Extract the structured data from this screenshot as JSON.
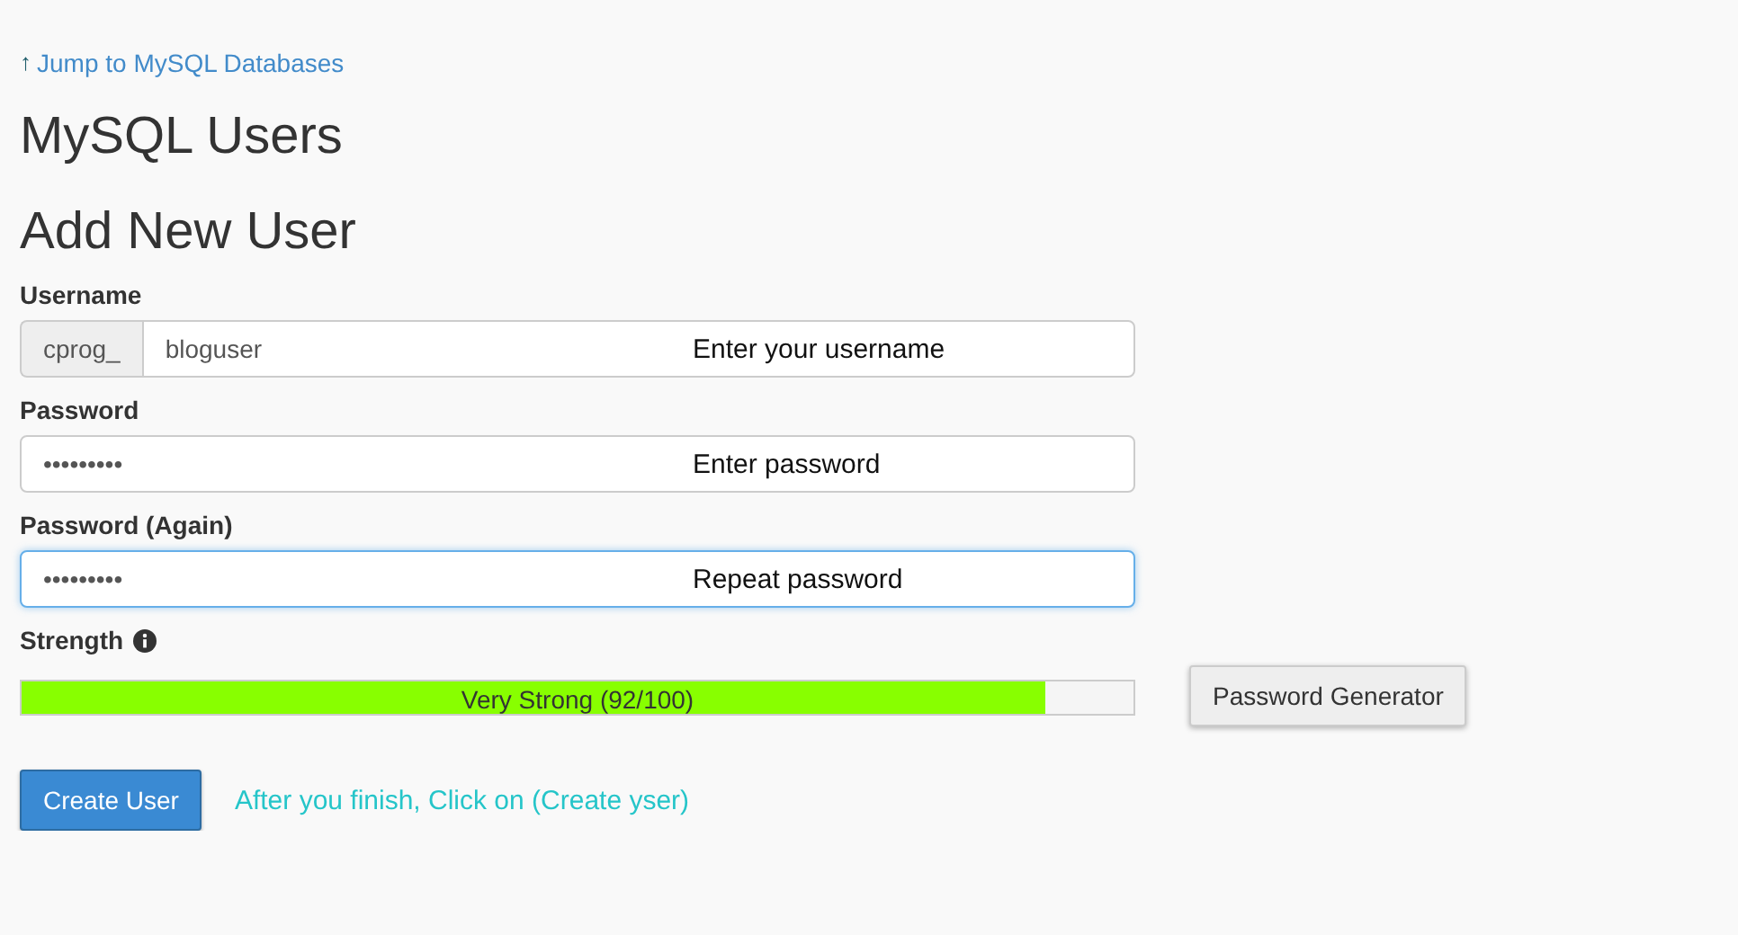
{
  "jump_link": {
    "arrow": "↑",
    "label": "Jump to MySQL Databases"
  },
  "page_title": "MySQL Users",
  "section_title": "Add New User",
  "fields": [
    {
      "label": "Username",
      "prefix": "cprog_",
      "value": "bloguser",
      "focused": false,
      "annotation": "Enter your username"
    },
    {
      "label": "Password",
      "value": "•••••••••",
      "focused": false,
      "annotation": "Enter password"
    },
    {
      "label": "Password (Again)",
      "value": "•••••••••",
      "focused": true,
      "annotation": "Repeat password"
    }
  ],
  "strength": {
    "label": "Strength",
    "level": 0.92,
    "reading": "Very Strong (92/100)"
  },
  "generator_button": "Password Generator",
  "create_button": "Create User",
  "hint": "After you finish, Click on (Create yser)"
}
